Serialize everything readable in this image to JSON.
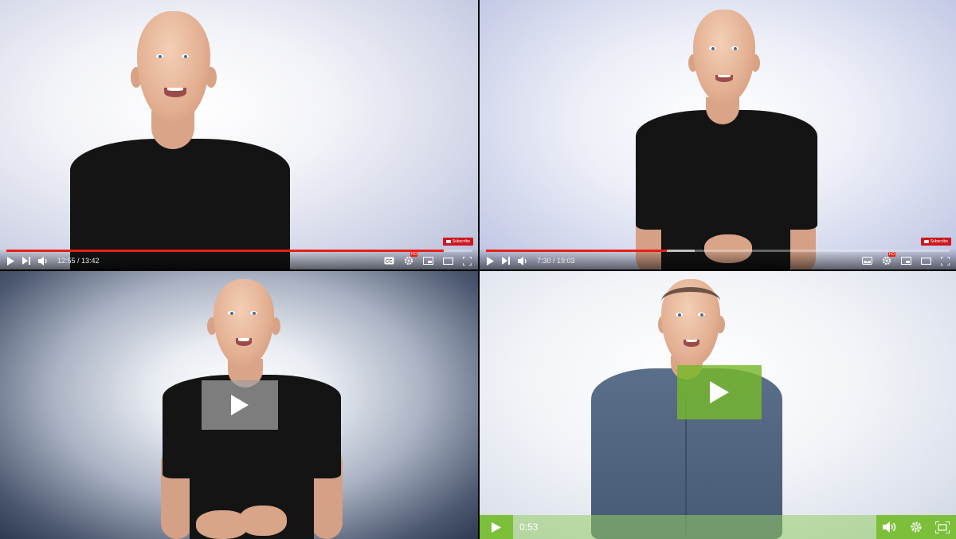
{
  "panels": [
    {
      "player": "youtube",
      "time": "12:55 / 13:42",
      "progress": 0.94,
      "subscribe_label": "Subscribe",
      "hd_badge": "HD",
      "controls": [
        "play-icon",
        "skip-next-icon",
        "volume-icon",
        "cc-icon",
        "settings-icon",
        "miniplayer-icon",
        "theater-icon",
        "fullscreen-icon"
      ]
    },
    {
      "player": "youtube",
      "time": "7:30 / 19:03",
      "progress": 0.39,
      "subscribe_label": "Subscribe",
      "hd_badge": "HD",
      "controls": [
        "play-icon",
        "skip-next-icon",
        "volume-icon",
        "subtitles-icon",
        "settings-icon",
        "miniplayer-icon",
        "theater-icon",
        "fullscreen-icon"
      ]
    },
    {
      "player": "gray-overlay",
      "controls": [
        "play-icon"
      ]
    },
    {
      "player": "green",
      "time": "0:53",
      "controls": [
        "play-icon",
        "volume-icon",
        "settings-icon",
        "fullscreen-icon"
      ],
      "accent": "#7cbf3a"
    }
  ],
  "colors": {
    "youtube_red": "#e62117",
    "green_accent": "#7cbf3a"
  }
}
